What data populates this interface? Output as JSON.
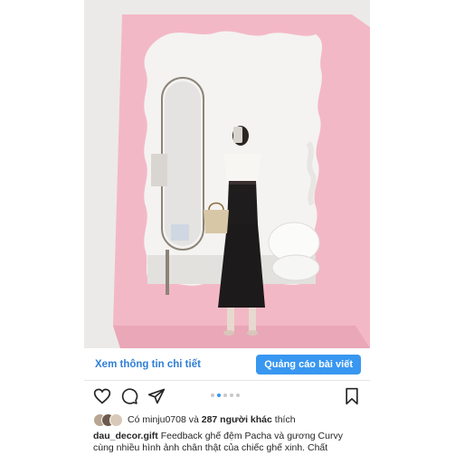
{
  "post": {
    "cta_link": "Xem thông tin chi tiết",
    "cta_button": "Quảng cáo bài viết",
    "carousel_total": 5,
    "carousel_active_index": 1
  },
  "likes": {
    "prefix": "Có",
    "first_user": "minju0708",
    "middle": "và",
    "others": "287 người khác",
    "suffix": "thích"
  },
  "caption": {
    "username": "dau_decor.gift",
    "line1": "Feedback ghế đệm Pacha và gương Curvy",
    "line2": "cùng nhiều hình ảnh chân thật của chiếc ghế xinh. Chất"
  },
  "colors": {
    "accent": "#3897f0",
    "mirror_frame": "#f3b8c6"
  },
  "icons": [
    "heart-icon",
    "comment-icon",
    "share-icon",
    "bookmark-icon"
  ]
}
